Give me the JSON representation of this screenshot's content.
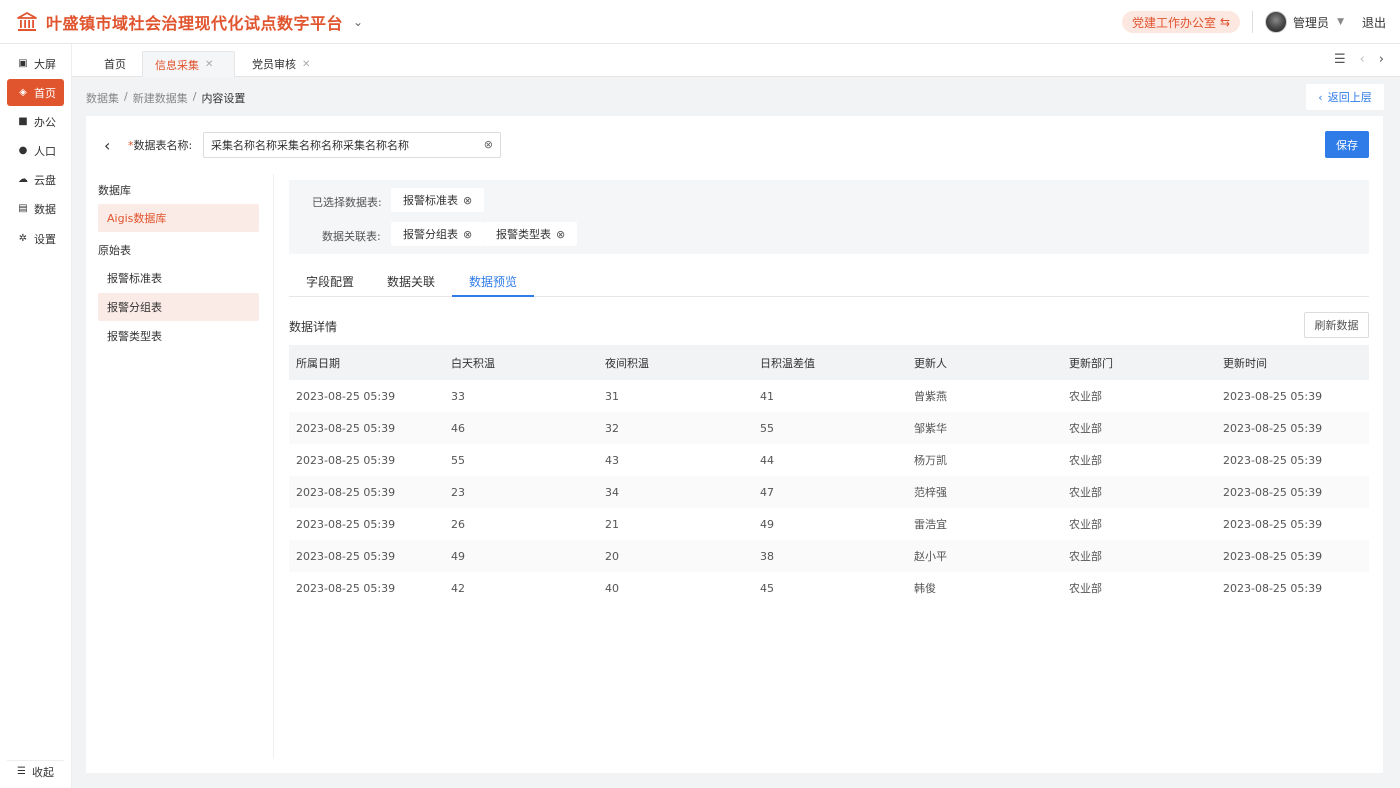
{
  "app": {
    "title": "叶盛镇市域社会治理现代化试点数字平台",
    "accent": "#e0542e"
  },
  "header": {
    "office": "党建工作办公室",
    "user": "管理员",
    "logout": "退出"
  },
  "sidebar": {
    "items": [
      {
        "label": "大屏",
        "icon": "screen-icon"
      },
      {
        "label": "首页",
        "icon": "layers-icon",
        "active": true
      },
      {
        "label": "办公",
        "icon": "briefcase-icon"
      },
      {
        "label": "人口",
        "icon": "person-icon"
      },
      {
        "label": "云盘",
        "icon": "cloud-icon"
      },
      {
        "label": "数据",
        "icon": "chart-icon"
      },
      {
        "label": "设置",
        "icon": "gear-icon"
      }
    ],
    "collapse": "收起"
  },
  "tabs": [
    {
      "label": "首页"
    },
    {
      "label": "信息采集",
      "active": true
    },
    {
      "label": "党员审核"
    }
  ],
  "breadcrumb": [
    "数据集",
    "新建数据集",
    "内容设置"
  ],
  "back_up": "返回上层",
  "form": {
    "name_label": "数据表名称:",
    "name_value": "采集名称名称采集名称名称采集名称名称",
    "save": "保存"
  },
  "left_pane": {
    "db_title": "数据库",
    "db_item": "Aigis数据库",
    "raw_title": "原始表",
    "tables": [
      "报警标准表",
      "报警分组表",
      "报警类型表"
    ]
  },
  "selection": {
    "selected_label": "已选择数据表:",
    "selected": [
      "报警标准表"
    ],
    "linked_label": "数据关联表:",
    "linked": [
      "报警分组表",
      "报警类型表"
    ]
  },
  "sub_tabs": [
    "字段配置",
    "数据关联",
    "数据预览"
  ],
  "detail": {
    "title": "数据详情",
    "refresh": "刷新数据"
  },
  "table": {
    "columns": [
      "所属日期",
      "白天积温",
      "夜间积温",
      "日积温差值",
      "更新人",
      "更新部门",
      "更新时间"
    ],
    "rows": [
      [
        "2023-08-25 05:39",
        "33",
        "31",
        "41",
        "曾紫燕",
        "农业部",
        "2023-08-25 05:39"
      ],
      [
        "2023-08-25 05:39",
        "46",
        "32",
        "55",
        "邹紫华",
        "农业部",
        "2023-08-25 05:39"
      ],
      [
        "2023-08-25 05:39",
        "55",
        "43",
        "44",
        "杨万凯",
        "农业部",
        "2023-08-25 05:39"
      ],
      [
        "2023-08-25 05:39",
        "23",
        "34",
        "47",
        "范梓强",
        "农业部",
        "2023-08-25 05:39"
      ],
      [
        "2023-08-25 05:39",
        "26",
        "21",
        "49",
        "雷浩宜",
        "农业部",
        "2023-08-25 05:39"
      ],
      [
        "2023-08-25 05:39",
        "49",
        "20",
        "38",
        "赵小平",
        "农业部",
        "2023-08-25 05:39"
      ],
      [
        "2023-08-25 05:39",
        "42",
        "40",
        "45",
        "韩俊",
        "农业部",
        "2023-08-25 05:39"
      ]
    ]
  }
}
